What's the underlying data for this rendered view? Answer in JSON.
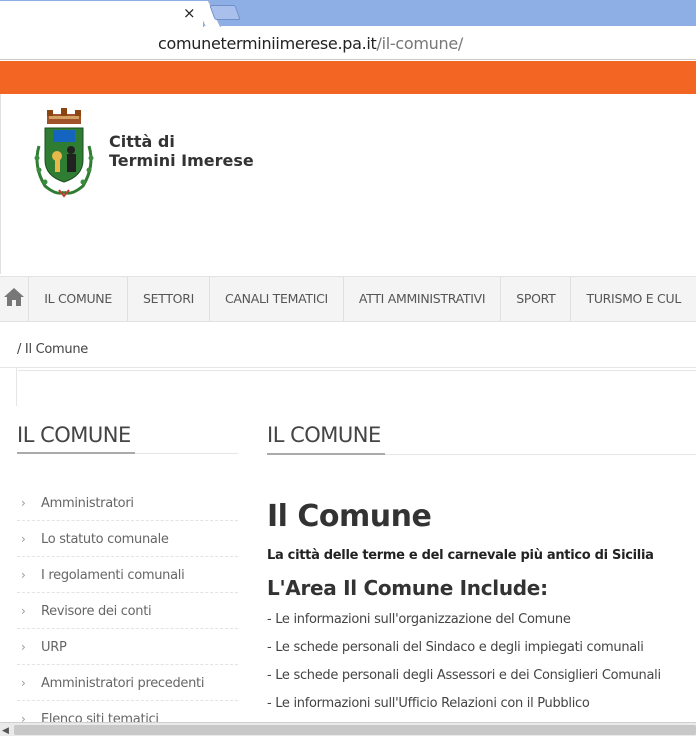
{
  "browser": {
    "tab_close_glyph": "×",
    "url_host": "comuneterminiimerese.pa.it",
    "url_path": "/il-comune/"
  },
  "site": {
    "brand_line1": "Città di",
    "brand_line2": "Termini Imerese",
    "accent_color": "#f26522"
  },
  "nav": {
    "home_icon": "home-icon",
    "items": [
      "IL COMUNE",
      "SETTORI",
      "CANALI TEMATICI",
      "ATTI AMMINISTRATIVI",
      "SPORT",
      "TURISMO E CUL"
    ]
  },
  "breadcrumb": "/ Il Comune",
  "sidebar": {
    "title": "IL COMUNE",
    "items": [
      "Amministratori",
      "Lo statuto comunale",
      "I regolamenti comunali",
      "Revisore dei conti",
      "URP",
      "Amministratori precedenti",
      "Elenco siti tematici"
    ]
  },
  "main": {
    "section_title": "IL COMUNE",
    "heading": "Il Comune",
    "subtitle": "La città delle terme e del carnevale più antico di Sicilia",
    "subheading": "L'Area Il Comune Include:",
    "bullets": [
      "- Le informazioni sull'organizzazione del Comune",
      "- Le schede personali del Sindaco e degli impiegati comunali",
      "- Le schede personali degli Assessori e dei Consiglieri Comunali",
      "- Le informazioni sull'Ufficio Relazioni con il Pubblico"
    ]
  }
}
